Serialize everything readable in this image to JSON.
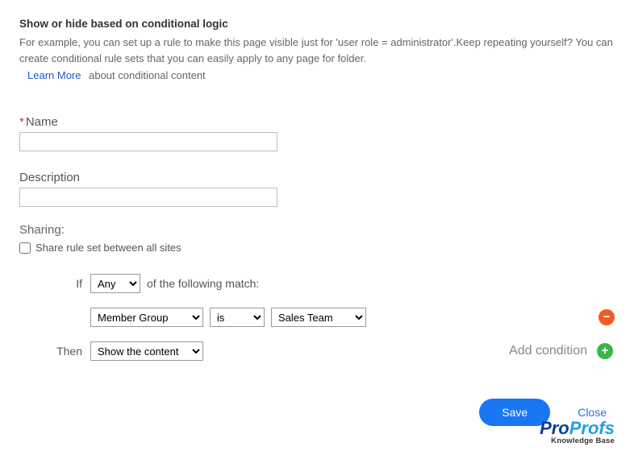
{
  "header": {
    "title": "Show or hide based on conditional logic",
    "help": "For example, you can set up a rule to make this page visible just for 'user role = administrator'.Keep repeating yourself? You can create conditional rule sets that you can easily apply to any page for folder.",
    "learn_more": "Learn More",
    "learn_rest": "about conditional content"
  },
  "fields": {
    "name_label": "Name",
    "name_value": "",
    "desc_label": "Description",
    "desc_value": "",
    "sharing_label": "Sharing:",
    "share_checkbox_label": "Share rule set between all sites",
    "share_checked": false
  },
  "rule": {
    "if_label": "If",
    "match_mode": "Any",
    "match_text": "of the following match:",
    "cond_field": "Member Group",
    "cond_op": "is",
    "cond_value": "Sales Team",
    "then_label": "Then",
    "then_action": "Show the content",
    "add_condition_label": "Add condition"
  },
  "buttons": {
    "save": "Save",
    "close": "Close"
  },
  "brand": {
    "part1": "Pro",
    "part2": "Profs",
    "sub": "Knowledge Base"
  }
}
